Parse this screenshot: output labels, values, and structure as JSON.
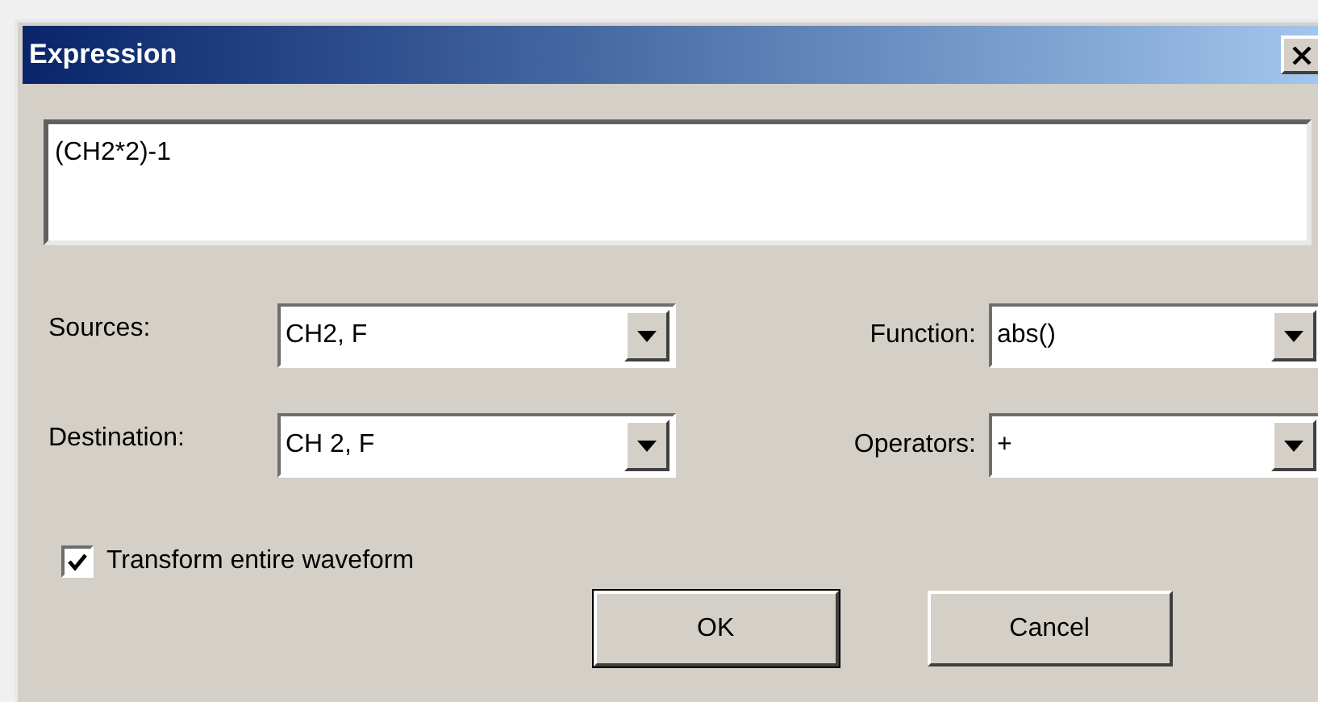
{
  "window": {
    "title": "Expression"
  },
  "expression": {
    "value": "(CH2*2)-1"
  },
  "fields": [
    {
      "label": "Sources:",
      "value": "CH2, F"
    },
    {
      "label": "Function:",
      "value": "abs()"
    },
    {
      "label": "Destination:",
      "value": "CH 2, F"
    },
    {
      "label": "Operators:",
      "value": "+"
    }
  ],
  "checkbox": {
    "label": "Transform entire waveform",
    "checked": true
  },
  "buttons": [
    {
      "label": "OK",
      "default": true
    },
    {
      "label": "Cancel",
      "default": false
    }
  ]
}
